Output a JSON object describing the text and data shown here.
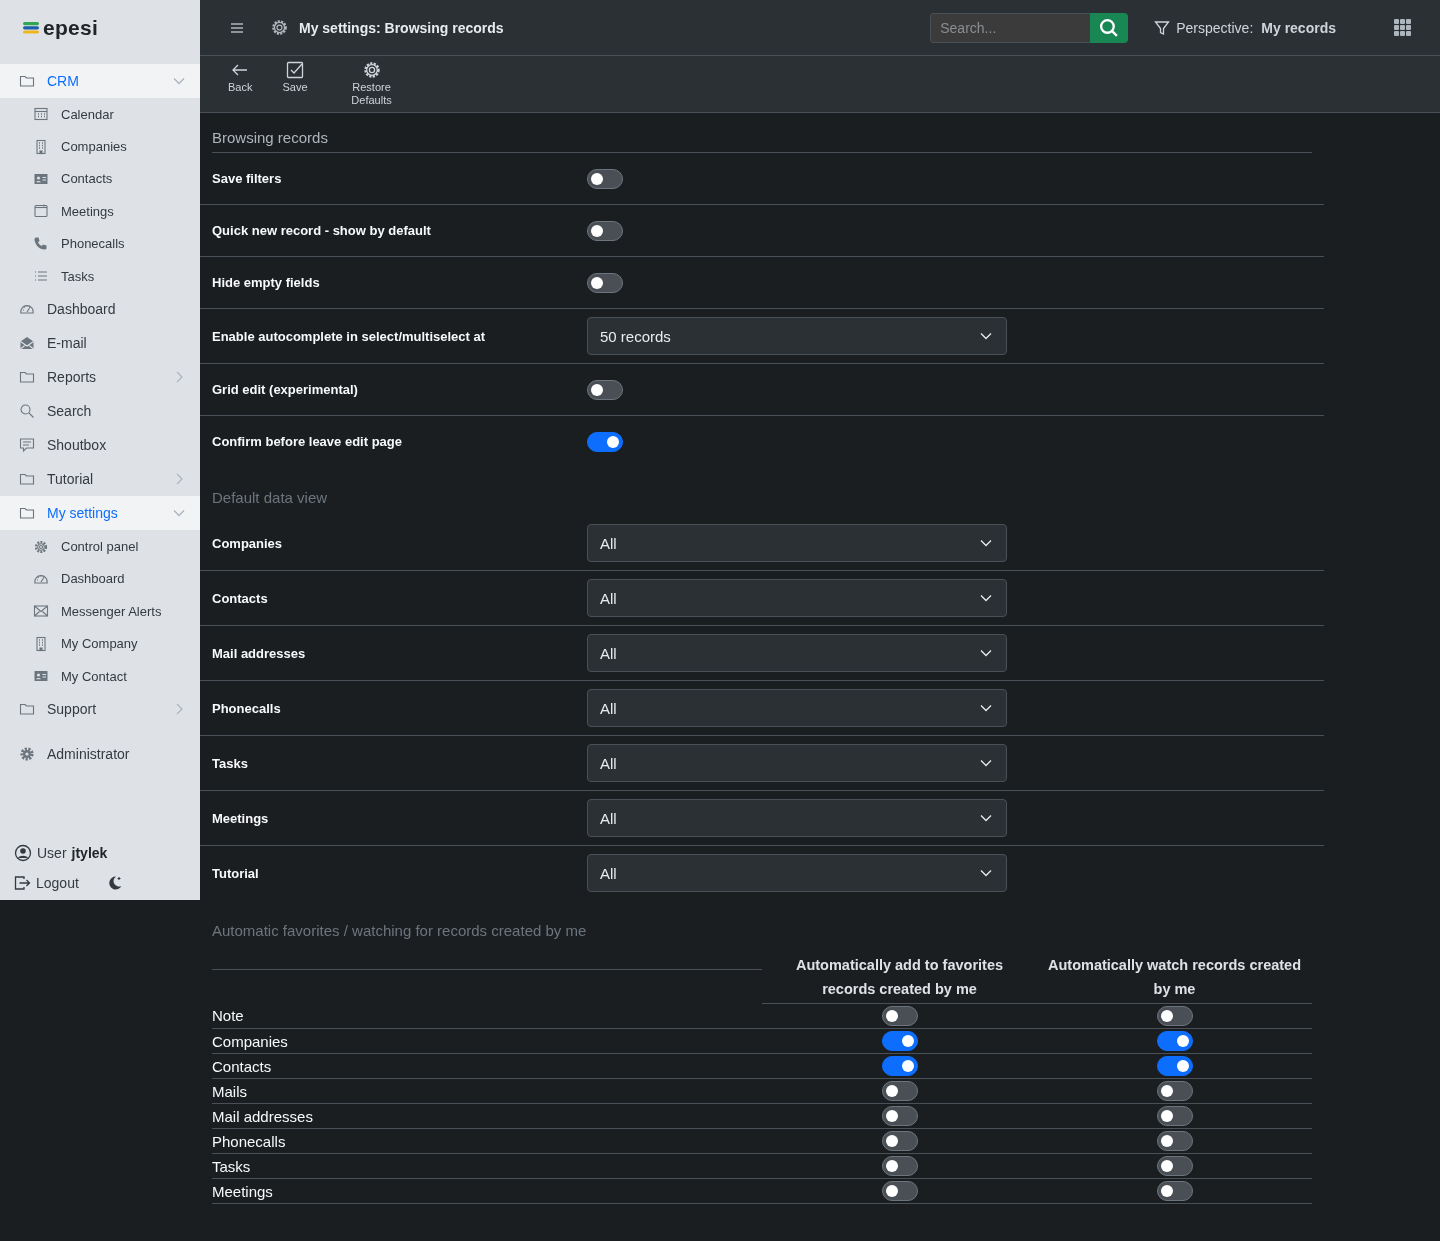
{
  "sidebar": {
    "logo": "epesi",
    "items": [
      {
        "label": "CRM",
        "kind": "folder",
        "selected": true,
        "expanded": true,
        "children": [
          {
            "label": "Calendar",
            "kind": "calendar",
            "selected": false
          },
          {
            "label": "Companies",
            "kind": "building",
            "selected": false
          },
          {
            "label": "Contacts",
            "kind": "contact",
            "selected": false
          },
          {
            "label": "Meetings",
            "kind": "meeting",
            "selected": false
          },
          {
            "label": "Phonecalls",
            "kind": "phone",
            "selected": false
          },
          {
            "label": "Tasks",
            "kind": "list",
            "selected": false
          }
        ]
      },
      {
        "label": "Dashboard",
        "kind": "gauge",
        "selected": false
      },
      {
        "label": "E-mail",
        "kind": "mail-open",
        "selected": false
      },
      {
        "label": "Reports",
        "kind": "folder",
        "selected": false,
        "expanded": false
      },
      {
        "label": "Search",
        "kind": "search",
        "selected": false
      },
      {
        "label": "Shoutbox",
        "kind": "chat",
        "selected": false
      },
      {
        "label": "Tutorial",
        "kind": "folder",
        "selected": false,
        "expanded": false
      },
      {
        "label": "My settings",
        "kind": "folder",
        "selected": true,
        "expanded": true,
        "children": [
          {
            "label": "Control panel",
            "kind": "gear",
            "selected": false
          },
          {
            "label": "Dashboard",
            "kind": "gauge",
            "selected": false
          },
          {
            "label": "Messenger Alerts",
            "kind": "envelope",
            "selected": false
          },
          {
            "label": "My Company",
            "kind": "building",
            "selected": false
          },
          {
            "label": "My Contact",
            "kind": "contact",
            "selected": false
          }
        ]
      },
      {
        "label": "Support",
        "kind": "folder",
        "selected": false,
        "expanded": false
      },
      {
        "label": "Administrator",
        "kind": "cog",
        "selected": false
      }
    ],
    "user": {
      "label": "User",
      "name": "jtylek"
    },
    "logout": "Logout"
  },
  "header": {
    "title": "My settings: Browsing records",
    "search": {
      "placeholder": "Search..."
    },
    "perspective": {
      "label": "Perspective:",
      "value": "My records"
    }
  },
  "toolbar": [
    {
      "kind": "back",
      "label": "Back"
    },
    {
      "kind": "save",
      "label": "Save"
    },
    {
      "kind": "restore",
      "label": "Restore Defaults"
    }
  ],
  "sections": [
    {
      "title": "Browsing records",
      "rows": [
        {
          "label": "Save filters",
          "kind": "toggle",
          "on": false
        },
        {
          "label": "Quick new record - show by default",
          "kind": "toggle",
          "on": false
        },
        {
          "label": "Hide empty fields",
          "kind": "toggle",
          "on": false
        },
        {
          "label": "Enable autocomplete in select/multiselect at",
          "kind": "select",
          "value": "50 records"
        },
        {
          "label": "Grid edit (experimental)",
          "kind": "toggle",
          "on": false
        },
        {
          "label": "Confirm before leave edit page",
          "kind": "toggle",
          "on": true
        }
      ]
    },
    {
      "title": "Default data view",
      "rows": [
        {
          "label": "Companies",
          "kind": "select",
          "value": "All"
        },
        {
          "label": "Contacts",
          "kind": "select",
          "value": "All"
        },
        {
          "label": "Mail addresses",
          "kind": "select",
          "value": "All"
        },
        {
          "label": "Phonecalls",
          "kind": "select",
          "value": "All"
        },
        {
          "label": "Tasks",
          "kind": "select",
          "value": "All"
        },
        {
          "label": "Meetings",
          "kind": "select",
          "value": "All"
        },
        {
          "label": "Tutorial",
          "kind": "select",
          "value": "All"
        }
      ]
    }
  ],
  "favorites": {
    "title": "Automatic favorites / watching for records created by me",
    "columns": [
      "Automatically add to favorites records created by me",
      "Automatically watch records created by me"
    ],
    "rows": [
      {
        "label": "Note",
        "favorite": false,
        "watch": false
      },
      {
        "label": "Companies",
        "favorite": true,
        "watch": true
      },
      {
        "label": "Contacts",
        "favorite": true,
        "watch": true
      },
      {
        "label": "Mails",
        "favorite": false,
        "watch": false
      },
      {
        "label": "Mail addresses",
        "favorite": false,
        "watch": false
      },
      {
        "label": "Phonecalls",
        "favorite": false,
        "watch": false
      },
      {
        "label": "Tasks",
        "favorite": false,
        "watch": false
      },
      {
        "label": "Meetings",
        "favorite": false,
        "watch": false
      }
    ]
  }
}
